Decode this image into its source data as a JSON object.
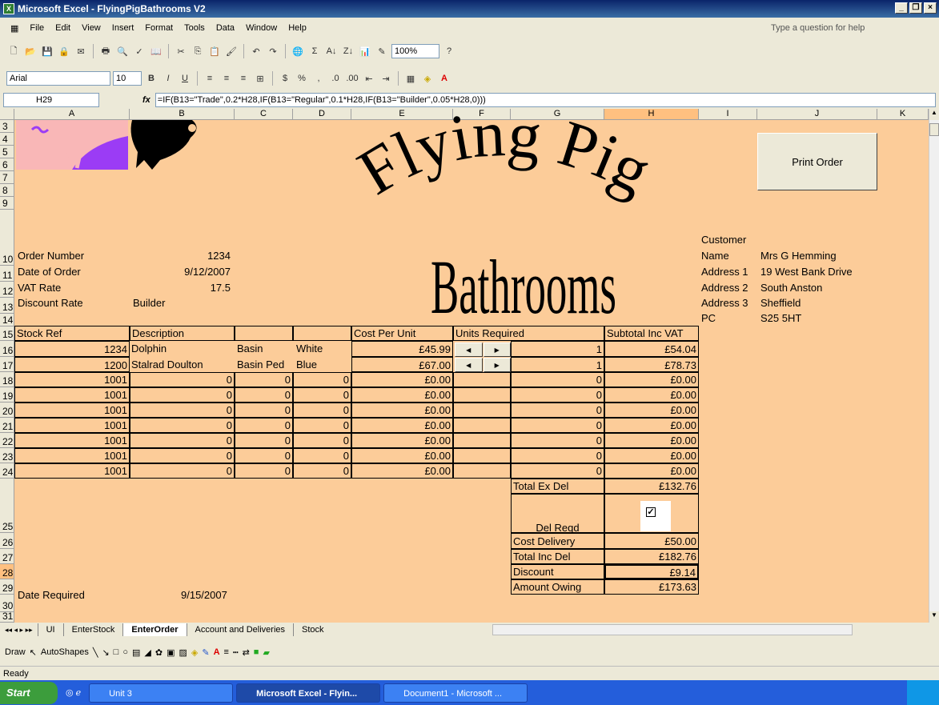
{
  "title": "Microsoft Excel - FlyingPigBathrooms V2",
  "menu": [
    "File",
    "Edit",
    "View",
    "Insert",
    "Format",
    "Tools",
    "Data",
    "Window",
    "Help"
  ],
  "help_placeholder": "Type a question for help",
  "zoom": "100%",
  "font": {
    "name": "Arial",
    "size": "10"
  },
  "formula_bar": {
    "cell": "H29",
    "formula": "=IF(B13=\"Trade\",0.2*H28,IF(B13=\"Regular\",0.1*H28,IF(B13=\"Builder\",0.05*H28,0)))"
  },
  "columns": [
    "A",
    "B",
    "C",
    "D",
    "E",
    "F",
    "G",
    "H",
    "I",
    "J",
    "K"
  ],
  "rows": [
    "3",
    "4",
    "5",
    "6",
    "7",
    "8",
    "9",
    "10",
    "11",
    "12",
    "13",
    "14",
    "15",
    "16",
    "17",
    "18",
    "19",
    "20",
    "21",
    "22",
    "23",
    "24",
    "25",
    "26",
    "27",
    "28",
    "29",
    "30",
    "31"
  ],
  "logo": {
    "line1": "Flying Pig",
    "line2": "Bathrooms"
  },
  "print_button": "Print Order",
  "order": {
    "order_number_label": "Order Number",
    "order_number": "1234",
    "date_label": "Date of Order",
    "date": "9/12/2007",
    "vat_label": "VAT Rate",
    "vat": "17.5",
    "discount_label": "Discount Rate",
    "discount": "Builder",
    "date_required_label": "Date Required",
    "date_required": "9/15/2007"
  },
  "customer": {
    "heading": "Customer",
    "name_label": "Name",
    "name": "Mrs G Hemming",
    "a1_label": "Address 1",
    "a1": "19 West Bank Drive",
    "a2_label": "Address 2",
    "a2": "South Anston",
    "a3_label": "Address 3",
    "a3": "Sheffield",
    "pc_label": "PC",
    "pc": "S25 5HT"
  },
  "table": {
    "headers": [
      "Stock Ref",
      "Description",
      "",
      "",
      "Cost Per Unit",
      "Units Required",
      "",
      "Subtotal Inc VAT"
    ],
    "rows": [
      [
        "1234",
        "Dolphin",
        "Basin",
        "White",
        "£45.99",
        "",
        "1",
        "£54.04"
      ],
      [
        "1200",
        "Stalrad Doulton",
        "Basin Ped",
        "Blue",
        "£67.00",
        "",
        "1",
        "£78.73"
      ],
      [
        "1001",
        "0",
        "0",
        "0",
        "£0.00",
        "",
        "0",
        "£0.00"
      ],
      [
        "1001",
        "0",
        "0",
        "0",
        "£0.00",
        "",
        "0",
        "£0.00"
      ],
      [
        "1001",
        "0",
        "0",
        "0",
        "£0.00",
        "",
        "0",
        "£0.00"
      ],
      [
        "1001",
        "0",
        "0",
        "0",
        "£0.00",
        "",
        "0",
        "£0.00"
      ],
      [
        "1001",
        "0",
        "0",
        "0",
        "£0.00",
        "",
        "0",
        "£0.00"
      ],
      [
        "1001",
        "0",
        "0",
        "0",
        "£0.00",
        "",
        "0",
        "£0.00"
      ],
      [
        "1001",
        "0",
        "0",
        "0",
        "£0.00",
        "",
        "0",
        "£0.00"
      ]
    ]
  },
  "totals": {
    "ex_del_label": "Total Ex Del",
    "ex_del": "£132.76",
    "del_reqd_label": "Del Reqd",
    "cost_del_label": "Cost Delivery",
    "cost_del": "£50.00",
    "inc_del_label": "Total Inc Del",
    "inc_del": "£182.76",
    "discount_label": "Discount",
    "discount": "£9.14",
    "owing_label": "Amount Owing",
    "owing": "£173.63"
  },
  "sheets": [
    "UI",
    "EnterStock",
    "EnterOrder",
    "Account and Deliveries",
    "Stock"
  ],
  "active_sheet": "EnterOrder",
  "draw": {
    "draw": "Draw",
    "autoshapes": "AutoShapes"
  },
  "status": "Ready",
  "taskbar": {
    "start": "Start",
    "items": [
      "Unit 3",
      "Microsoft Excel - Flyin...",
      "Document1 - Microsoft ..."
    ]
  }
}
